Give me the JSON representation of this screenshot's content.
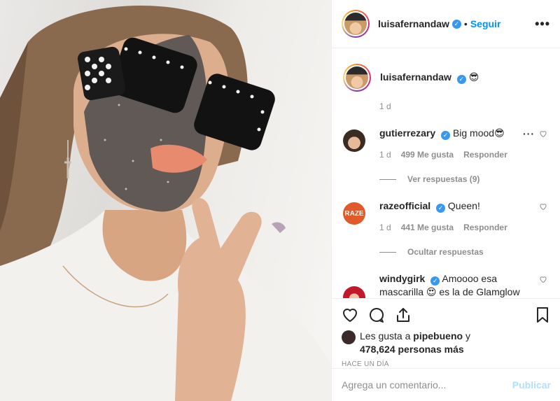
{
  "post": {
    "author": "luisafernandaw",
    "follow_label": "Seguir",
    "separator": "•",
    "more_label": "•••",
    "caption_emoji": "😎",
    "caption_time": "1 d"
  },
  "comments": [
    {
      "user": "gutierrezary",
      "text": "Big mood😎",
      "time": "1 d",
      "likes": "499 Me gusta",
      "reply": "Responder",
      "thread": "Ver respuestas (9)"
    },
    {
      "user": "razeofficial",
      "text": "Queen!",
      "time": "1 d",
      "likes": "441 Me gusta",
      "reply": "Responder",
      "thread": "Ocultar respuestas",
      "avatar_text": "RAZE"
    },
    {
      "user": "windygirk",
      "text": "Amoooo esa mascarilla 😍 es la de Glamglow verdad?💕✨💎"
    }
  ],
  "likes": {
    "prefix": "Les gusta a ",
    "user": "pipebueno",
    "connector": " y",
    "count": "478,624 personas más"
  },
  "timestamp": "HACE UN DÍA",
  "add_comment": {
    "placeholder": "Agrega un comentario...",
    "publish": "Publicar"
  },
  "colors": {
    "accent": "#0095f6",
    "verified": "#3897f0",
    "muted": "#8e8e8e",
    "publish_disabled": "#b2dffc"
  }
}
